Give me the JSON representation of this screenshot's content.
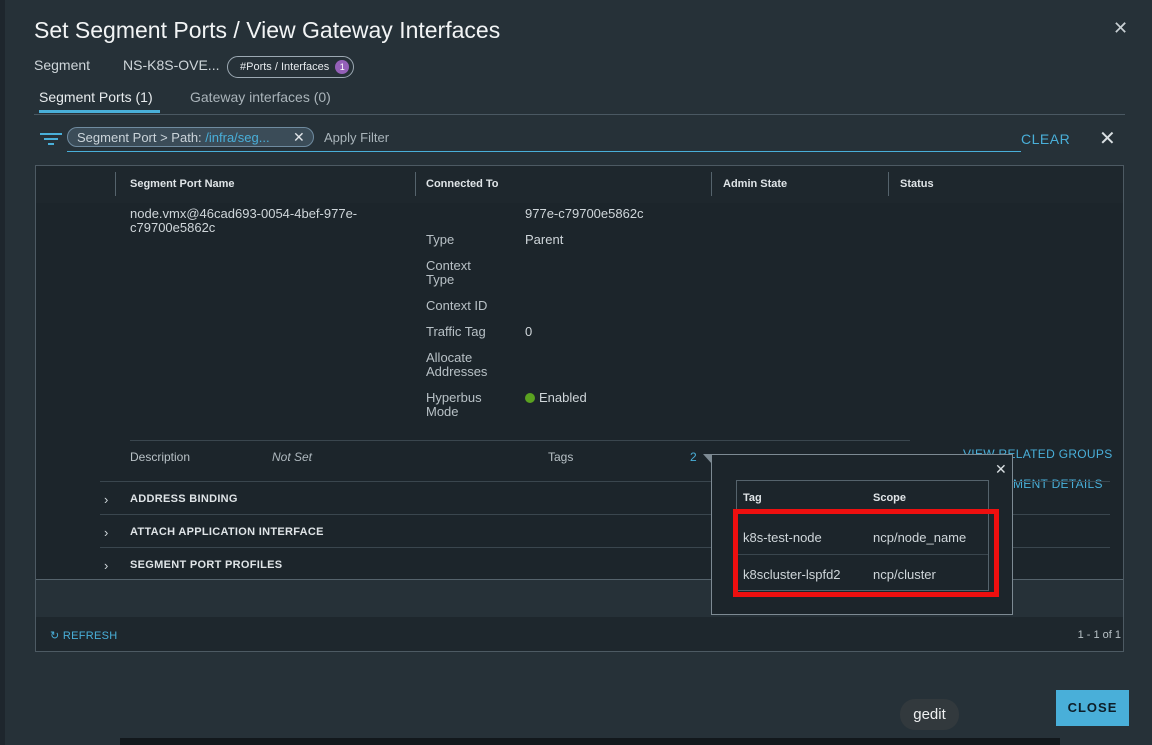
{
  "modal": {
    "title": "Set Segment Ports / View Gateway Interfaces",
    "segment_label": "Segment",
    "segment_value": "NS-K8S-OVE...",
    "pill_label": "#Ports / Interfaces",
    "pill_count": "1"
  },
  "tabs": [
    {
      "label": "Segment Ports (1)",
      "active": true
    },
    {
      "label": "Gateway interfaces (0)",
      "active": false
    }
  ],
  "filter": {
    "chip_key": "Segment Port > Path: ",
    "chip_value": "/infra/seg...",
    "placeholder": "Apply Filter",
    "clear_label": "CLEAR"
  },
  "table": {
    "columns": [
      "Segment Port Name",
      "Connected To",
      "Admin State",
      "Status"
    ],
    "port_name": "node.vmx@46cad693-0054-4bef-977e-c79700e5862c",
    "connected_to_partial": "977e-c79700e5862c",
    "details": [
      {
        "key": "Type",
        "value": "Parent"
      },
      {
        "key": "Context Type",
        "value": ""
      },
      {
        "key": "Context ID",
        "value": ""
      },
      {
        "key": "Traffic Tag",
        "value": "0"
      },
      {
        "key": "Allocate Addresses",
        "value": ""
      },
      {
        "key": "Hyperbus Mode",
        "value": "Enabled"
      }
    ],
    "description_label": "Description",
    "description_value": "Not Set",
    "tags_label": "Tags",
    "tags_count": "2",
    "view_related_groups": "VIEW RELATED GROUPS",
    "attachment_details": "HMENT DETAILS",
    "sections": [
      "ADDRESS BINDING",
      "ATTACH APPLICATION INTERFACE",
      "SEGMENT PORT PROFILES"
    ],
    "refresh_label": "REFRESH",
    "paging": "1 - 1 of 1"
  },
  "tags_popover": {
    "columns": [
      "Tag",
      "Scope"
    ],
    "rows": [
      {
        "tag": "k8s-test-node",
        "scope": "ncp/node_name"
      },
      {
        "tag": "k8scluster-lspfd2",
        "scope": "ncp/cluster"
      }
    ]
  },
  "taskbar_tooltip": "gedit",
  "close_button": "CLOSE",
  "colors": {
    "accent": "#49afd9",
    "highlight": "#ee0f0f",
    "enabled": "#5aa220",
    "badge": "#9460b8"
  }
}
